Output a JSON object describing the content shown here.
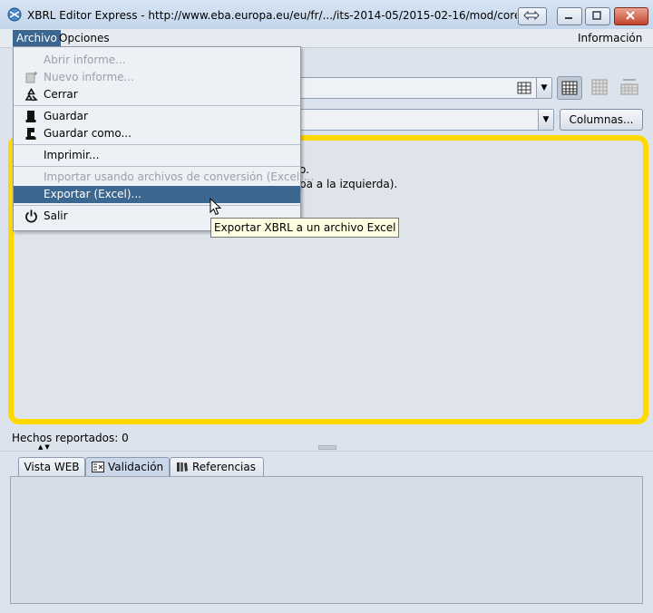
{
  "window": {
    "title": "XBRL Editor Express - http://www.eba.europa.eu/eu/fr/.../its-2014-05/2015-02-16/mod/corep_lcr_ind.xsd",
    "icon": "xbrl-globe-icon"
  },
  "menubar": {
    "archivo": "Archivo",
    "opciones": "Opciones",
    "informacion": "Información"
  },
  "dropdown": {
    "items": [
      {
        "label": "Abrir informe...",
        "icon": "open-icon",
        "enabled": false
      },
      {
        "label": "Nuevo informe...",
        "icon": "new-report-icon",
        "enabled": false
      },
      {
        "label": "Cerrar",
        "icon": "recycle-icon",
        "enabled": true
      },
      {
        "label": "Guardar",
        "icon": "save-icon",
        "enabled": true
      },
      {
        "label": "Guardar como...",
        "icon": "save-as-icon",
        "enabled": true
      },
      {
        "label": "Imprimir...",
        "icon": "",
        "enabled": true
      },
      {
        "label": "Importar usando archivos de conversión (Excel)...",
        "icon": "",
        "enabled": false
      },
      {
        "label": "Exportar (Excel)...",
        "icon": "",
        "enabled": true,
        "selected": true
      },
      {
        "label": "Salir",
        "icon": "power-icon",
        "enabled": true
      }
    ]
  },
  "tooltip": "Exportar XBRL a un archivo Excel",
  "toolbar": {
    "columnas": "Columnas..."
  },
  "content": {
    "line1": "o.",
    "line2": "pa a la izquierda)."
  },
  "status": {
    "hechos": "Hechos reportados: 0"
  },
  "tabs": [
    {
      "label": "Vista WEB",
      "icon": ""
    },
    {
      "label": "Validación",
      "icon": "validation-icon"
    },
    {
      "label": "Referencias",
      "icon": "books-icon"
    }
  ],
  "colors": {
    "accent": "#3b6790",
    "highlight_border": "#ffd800",
    "tooltip_bg": "#ffffe1"
  }
}
